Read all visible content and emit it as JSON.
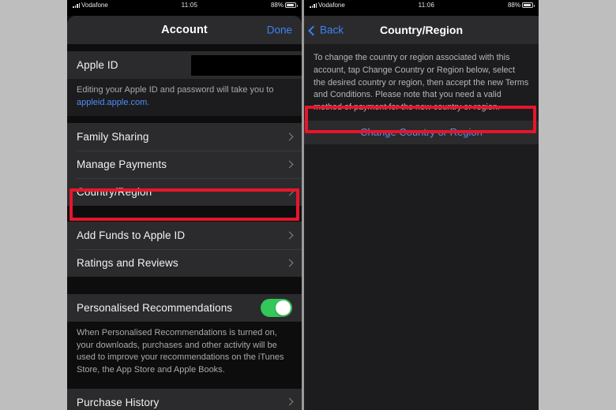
{
  "left_phone": {
    "status_bar": {
      "carrier": "Vodafone",
      "time": "11:05",
      "battery_label": "88%"
    },
    "nav": {
      "title": "Account",
      "done_label": "Done"
    },
    "apple_id_row": {
      "label": "Apple ID",
      "value_redacted": true
    },
    "apple_id_note": {
      "text": "Editing your Apple ID and password will take you to ",
      "link": "appleid.apple.com."
    },
    "group_one": [
      {
        "label": "Family Sharing",
        "accessory": "chevron-right-icon"
      },
      {
        "label": "Manage Payments",
        "accessory": "chevron-right-icon"
      },
      {
        "label": "Country/Region",
        "accessory": "chevron-right-icon",
        "highlighted": true
      }
    ],
    "group_two": [
      {
        "label": "Add Funds to Apple ID",
        "accessory": "chevron-right-icon"
      },
      {
        "label": "Ratings and Reviews",
        "accessory": "chevron-right-icon"
      }
    ],
    "personalised": {
      "label": "Personalised Recommendations",
      "toggle_on": true,
      "note": "When Personalised Recommendations is turned on, your downloads, purchases and other activity will be used to improve your recommendations on the iTunes Store, the App Store and Apple Books."
    },
    "partial_row": {
      "label": "Purchase History"
    }
  },
  "right_phone": {
    "status_bar": {
      "carrier": "Vodafone",
      "time": "11:06",
      "battery_label": "88%"
    },
    "nav": {
      "back_label": "Back",
      "title": "Country/Region"
    },
    "description": "To change the country or region associated with this account, tap Change Country or Region below, select the desired country or region, then accept the new Terms and Conditions. Please note that you need a valid method of payment for the new country or region.",
    "action_button": {
      "label": "Change Country or Region",
      "highlighted": true
    }
  },
  "colors": {
    "page_background": "#bebebe",
    "panel_background": "#1c1c1e",
    "row_background": "#2b2b2d",
    "accent_blue": "#3b82f6",
    "highlight_red": "#e8152b",
    "toggle_green": "#34c759"
  }
}
